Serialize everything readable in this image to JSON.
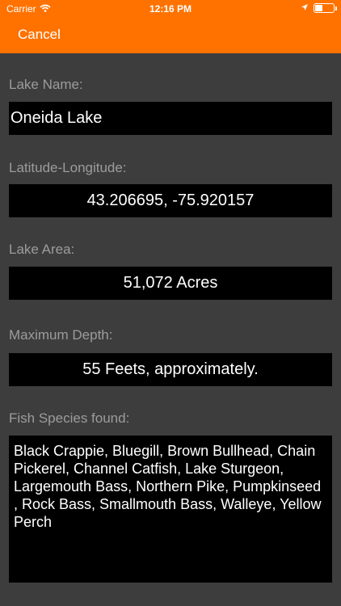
{
  "status_bar": {
    "carrier": "Carrier",
    "time": "12:16 PM",
    "battery_level_fraction": 0.4
  },
  "nav": {
    "cancel_label": "Cancel",
    "bar_color": "#ff7200"
  },
  "form": {
    "lake_name": {
      "label": "Lake Name:",
      "value": "Oneida Lake"
    },
    "lat_long": {
      "label": "Latitude-Longitude:",
      "value": "43.206695, -75.920157"
    },
    "lake_area": {
      "label": "Lake Area:",
      "value": "51,072 Acres"
    },
    "max_depth": {
      "label": "Maximum Depth:",
      "value": "55 Feets, approximately."
    },
    "fish_species": {
      "label": "Fish Species found:",
      "value": "Black Crappie, Bluegill, Brown Bullhead, Chain Pickerel, Channel Catfish, Lake Sturgeon, Largemouth Bass, Northern Pike, Pumpkinseed , Rock Bass, Smallmouth Bass, Walleye, Yellow Perch"
    }
  }
}
